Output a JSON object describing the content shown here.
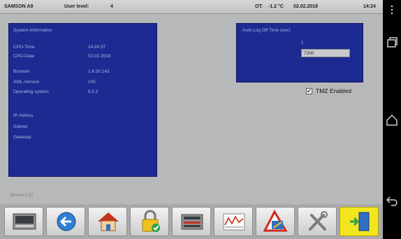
{
  "header": {
    "device": "SAMSON A9",
    "user_level_label": "User level:",
    "user_level_value": "4",
    "ot_label": "OT:",
    "ot_value": "-1.2 °C",
    "date": "02.02.2018",
    "time": "14:24"
  },
  "system_info": {
    "title": "System information",
    "rows": [
      {
        "label": "CPO-Time",
        "value": "14:24:37"
      },
      {
        "label": "CPO-Date",
        "value": "02.02.2018"
      },
      {
        "label": "Browser",
        "value": "1.6.30.142"
      },
      {
        "label": "XML-Version",
        "value": "105"
      },
      {
        "label": "Operating system",
        "value": "9.0.2"
      },
      {
        "label": "IP-Adress",
        "value": ""
      },
      {
        "label": "Subnet",
        "value": ""
      },
      {
        "label": "Gateway",
        "value": ""
      }
    ]
  },
  "auto_logoff": {
    "title": "Auto Log Off Time (sec)",
    "row1_label": "···········",
    "row1_value": "1",
    "row2_label": "···········",
    "timeout_value": "7200"
  },
  "tmz": {
    "label": "TMZ Enabled",
    "checked": true
  },
  "version": "Version 2.10",
  "toolbar": {
    "buttons": [
      {
        "name": "device-overview-button",
        "icon": "controller-icon"
      },
      {
        "name": "back-button",
        "icon": "arrow-left-icon"
      },
      {
        "name": "home-button",
        "icon": "house-icon"
      },
      {
        "name": "login-button",
        "icon": "padlock-icon"
      },
      {
        "name": "io-list-button",
        "icon": "io-module-icon"
      },
      {
        "name": "trend-button",
        "icon": "trend-chart-icon"
      },
      {
        "name": "alarm-button",
        "icon": "warning-icon"
      },
      {
        "name": "settings-button",
        "icon": "tools-icon"
      },
      {
        "name": "exit-button",
        "icon": "exit-door-icon"
      }
    ]
  },
  "colors": {
    "panel": "#1d2a92",
    "background": "#b7b8ba",
    "active_button": "#f2e61e"
  }
}
